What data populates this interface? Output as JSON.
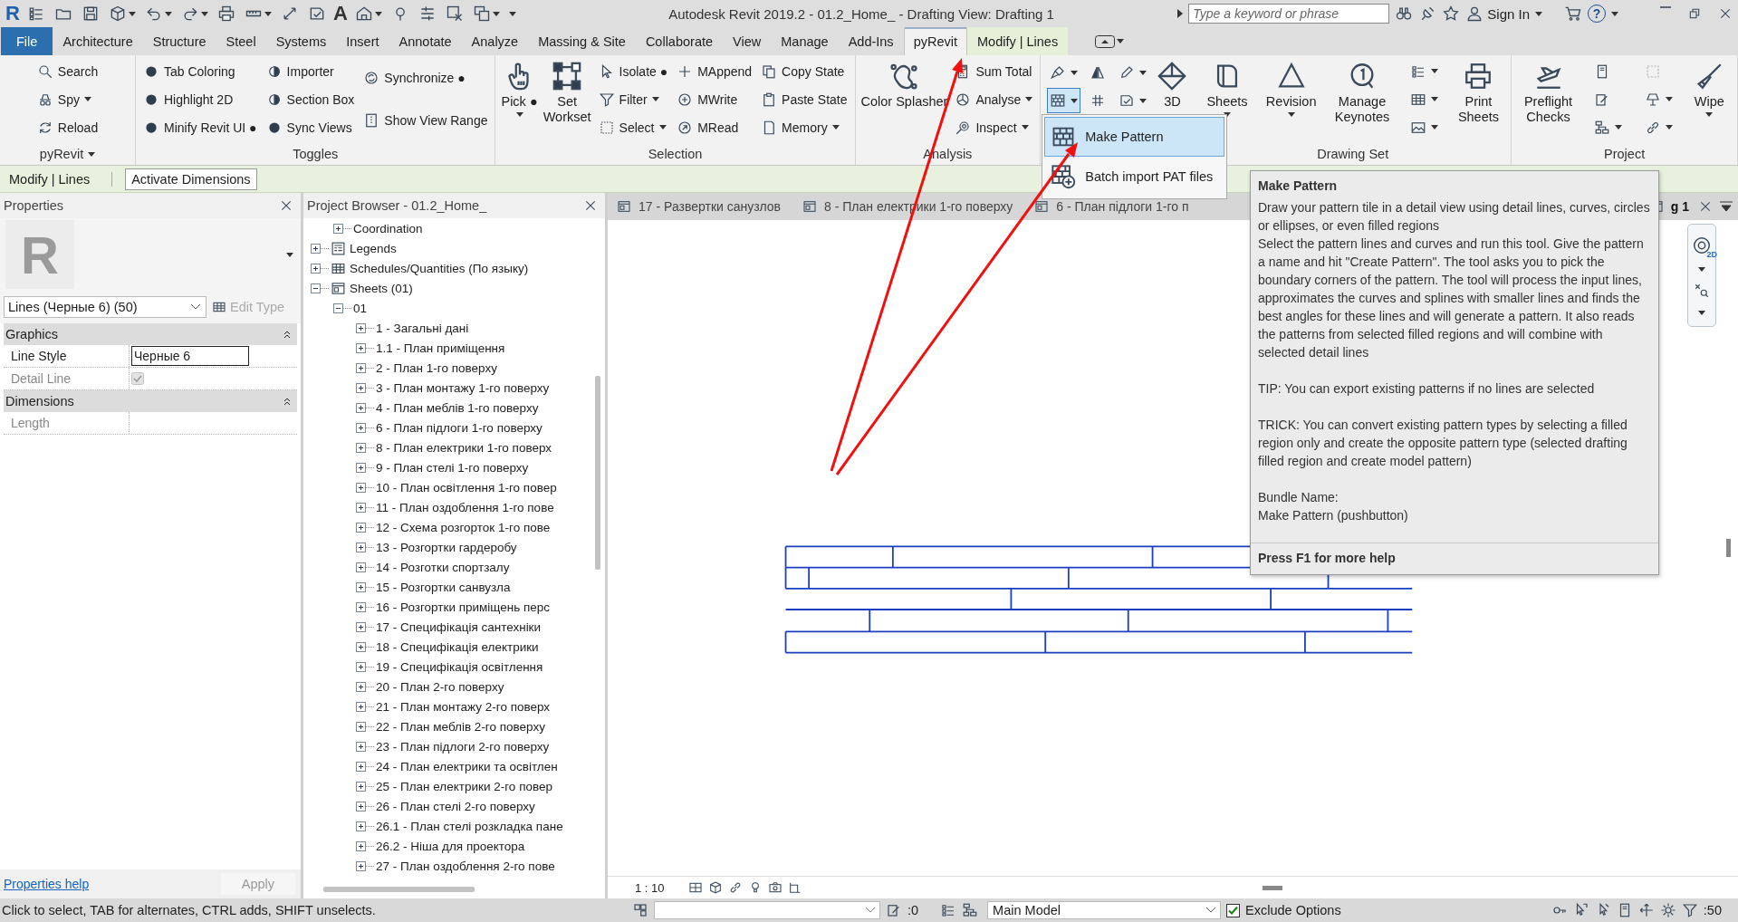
{
  "app_logo": "R",
  "title": "Autodesk Revit 2019.2 - 01.2_Home_ - Drafting View: Drafting 1",
  "qat_text_glyph": "A",
  "search": {
    "placeholder": "Type a keyword or phrase"
  },
  "sign_in": "Sign In",
  "help_glyph": "?",
  "ribbon_tabs": [
    {
      "label": "File",
      "kind": "file",
      "selected": false
    },
    {
      "label": "Architecture",
      "kind": "normal",
      "selected": false
    },
    {
      "label": "Structure",
      "kind": "normal",
      "selected": false
    },
    {
      "label": "Steel",
      "kind": "normal",
      "selected": false
    },
    {
      "label": "Systems",
      "kind": "normal",
      "selected": false
    },
    {
      "label": "Insert",
      "kind": "normal",
      "selected": false
    },
    {
      "label": "Annotate",
      "kind": "normal",
      "selected": false
    },
    {
      "label": "Analyze",
      "kind": "normal",
      "selected": false
    },
    {
      "label": "Massing & Site",
      "kind": "normal",
      "selected": false
    },
    {
      "label": "Collaborate",
      "kind": "normal",
      "selected": false
    },
    {
      "label": "View",
      "kind": "normal",
      "selected": false
    },
    {
      "label": "Manage",
      "kind": "normal",
      "selected": false
    },
    {
      "label": "Add-Ins",
      "kind": "normal",
      "selected": false
    },
    {
      "label": "pyRevit",
      "kind": "normal",
      "selected": true
    },
    {
      "label": "Modify | Lines",
      "kind": "contextual",
      "selected": false
    }
  ],
  "ribbon_panels": [
    {
      "title": "pyRevit",
      "title_dropdown": true,
      "columns": [
        {
          "kind": "stack",
          "items": [
            {
              "label": "Search",
              "dropdown": false
            },
            {
              "label": "Spy",
              "dropdown": true
            },
            {
              "label": "Reload",
              "dropdown": false
            }
          ]
        }
      ]
    },
    {
      "title": "Toggles",
      "title_dropdown": false,
      "columns": [
        {
          "kind": "stack",
          "items": [
            {
              "label": "Tab Coloring",
              "dropdown": false
            },
            {
              "label": "Highlight 2D",
              "dropdown": false
            },
            {
              "label": "Minify Revit UI ●",
              "dropdown": false
            }
          ]
        },
        {
          "kind": "stack",
          "items": [
            {
              "label": "Importer",
              "dropdown": false
            },
            {
              "label": "Section Box",
              "dropdown": false
            },
            {
              "label": "Sync Views",
              "dropdown": false
            }
          ]
        },
        {
          "kind": "stack",
          "items": [
            {
              "label": "Synchronize ●",
              "dropdown": false
            },
            {
              "label": "Show View Range",
              "dropdown": false
            }
          ]
        }
      ]
    },
    {
      "title": "Selection",
      "title_dropdown": false,
      "columns": [
        {
          "kind": "large",
          "label": "Pick ●",
          "dropdown": true
        },
        {
          "kind": "large",
          "label": "Set\nWorkset",
          "dropdown": false
        },
        {
          "kind": "stack",
          "items": [
            {
              "label": "Isolate ●",
              "dropdown": false
            },
            {
              "label": "Filter",
              "dropdown": true
            },
            {
              "label": "Select",
              "dropdown": true
            }
          ]
        },
        {
          "kind": "stack",
          "items": [
            {
              "label": "MAppend",
              "dropdown": false
            },
            {
              "label": "MWrite",
              "dropdown": false
            },
            {
              "label": "MRead",
              "dropdown": false
            }
          ]
        },
        {
          "kind": "stack",
          "items": [
            {
              "label": "Copy State",
              "dropdown": false
            },
            {
              "label": "Paste State",
              "dropdown": false
            },
            {
              "label": "Memory",
              "dropdown": true
            }
          ]
        }
      ]
    },
    {
      "title": "Analysis",
      "title_dropdown": false,
      "columns": [
        {
          "kind": "large",
          "label": "Color Splasher",
          "dropdown": false
        },
        {
          "kind": "stack",
          "items": [
            {
              "label": "Sum Total",
              "dropdown": false
            },
            {
              "label": "Analyse",
              "dropdown": true
            },
            {
              "label": "Inspect",
              "dropdown": true
            }
          ]
        }
      ]
    },
    {
      "columns": [
        {
          "kind": "stack",
          "items": [
            {
              "dropdown": true,
              "pressed": false
            },
            {
              "dropdown": true,
              "pressed": true
            }
          ]
        },
        {
          "kind": "stack",
          "items": [
            {
              "dropdown": false,
              "pressed": false
            },
            {
              "dropdown": false,
              "pressed": false
            }
          ]
        },
        {
          "kind": "stack",
          "items": [
            {
              "dropdown": true,
              "pressed": false
            },
            {
              "dropdown": true,
              "pressed": false
            }
          ]
        },
        {
          "kind": "large",
          "label": "3D",
          "dropdown": false
        }
      ]
    },
    {
      "title": "Drawing Set",
      "title_dropdown": false,
      "columns": [
        {
          "kind": "large",
          "label": "Sheets",
          "dropdown": true
        },
        {
          "kind": "large",
          "label": "Revision",
          "dropdown": true
        },
        {
          "kind": "large",
          "label": "Manage\nKeynotes",
          "dropdown": false
        },
        {
          "kind": "stack",
          "items": [
            {
              "dropdown": true
            },
            {
              "dropdown": true
            },
            {
              "dropdown": true
            }
          ]
        },
        {
          "kind": "large",
          "label": "Print\nSheets",
          "dropdown": false
        }
      ]
    },
    {
      "title": "Project",
      "title_dropdown": false,
      "columns": [
        {
          "kind": "large",
          "label": "Preflight\nChecks",
          "dropdown": false
        },
        {
          "kind": "stack",
          "items": [
            {
              "dropdown": false
            },
            {
              "dropdown": false
            },
            {
              "dropdown": true
            }
          ]
        },
        {
          "kind": "stack",
          "items": [
            {
              "dropdown": false,
              "disabled": true
            },
            {
              "dropdown": true,
              "disabled": false
            },
            {
              "dropdown": true,
              "disabled": false
            }
          ]
        },
        {
          "kind": "large",
          "label": "Wipe",
          "dropdown": true
        }
      ]
    }
  ],
  "dropdown_menu": [
    {
      "label": "Make Pattern",
      "highlighted": true
    },
    {
      "label": "Batch import PAT files",
      "highlighted": false
    }
  ],
  "context_bar": {
    "label": "Modify | Lines",
    "button": "Activate Dimensions"
  },
  "properties": {
    "title": "Properties",
    "thumbnail_letter": "R",
    "type_selector": "Lines (Черные 6) (50)",
    "edit_type": {
      "label": "Edit Type",
      "disabled": true
    },
    "sections": [
      {
        "title": "Graphics",
        "expanded": true,
        "rows": [
          {
            "name": "Line Style",
            "kind": "text",
            "value": "Черные 6",
            "disabled": false
          },
          {
            "name": "Detail Line",
            "kind": "checkbox",
            "checked": true,
            "disabled": true
          }
        ]
      },
      {
        "title": "Dimensions",
        "expanded": true,
        "rows": [
          {
            "name": "Length",
            "kind": "text",
            "disabled": true
          }
        ]
      }
    ],
    "help_link": "Properties help",
    "apply": {
      "label": "Apply",
      "disabled": true
    }
  },
  "project_browser": {
    "title": "Project Browser - 01.2_Home_",
    "tree": [
      {
        "expanded": true,
        "children": [
          {
            "label": "Coordination",
            "expanded": false
          }
        ]
      },
      {
        "label": "Legends",
        "kind": "legends",
        "expanded": false
      },
      {
        "label": "Schedules/Quantities (По языку)",
        "kind": "schedules",
        "expanded": false
      },
      {
        "label": "Sheets (01)",
        "kind": "sheets",
        "expanded": true,
        "children": [
          {
            "label": "01",
            "expanded": true,
            "children": [
              {
                "label": "1 - Загальні дані",
                "expanded": false
              },
              {
                "label": "1.1 - План приміщення",
                "expanded": false
              },
              {
                "label": "2 - План 1-го поверху",
                "expanded": false
              },
              {
                "label": "3 - План монтажу 1-го поверху",
                "expanded": false
              },
              {
                "label": "4 - План меблів 1-го поверху",
                "expanded": false
              },
              {
                "label": "6 - План підлоги 1-го поверху",
                "expanded": false
              },
              {
                "label": "8 - План електрики 1-го поверх",
                "expanded": false
              },
              {
                "label": "9 - План стелі 1-го поверху",
                "expanded": false
              },
              {
                "label": "10 - План освітлення 1-го повер",
                "expanded": false
              },
              {
                "label": "11 - План оздоблення 1-го пове",
                "expanded": false
              },
              {
                "label": "12 - Схема розгорток 1-го пове",
                "expanded": false
              },
              {
                "label": "13 - Розгортки гардеробу",
                "expanded": false
              },
              {
                "label": "14 - Розготки спортзалу",
                "expanded": false
              },
              {
                "label": "15 - Розгортки санвузла",
                "expanded": false
              },
              {
                "label": "16 - Розгортки приміщень перс",
                "expanded": false
              },
              {
                "label": "17 - Специфікація сантехніки",
                "expanded": false
              },
              {
                "label": "18 - Специфікація електрики",
                "expanded": false
              },
              {
                "label": "19 - Специфікація освітлення",
                "expanded": false
              },
              {
                "label": "20 - План 2-го поверху",
                "expanded": false
              },
              {
                "label": "21 - План монтажу 2-го поверх",
                "expanded": false
              },
              {
                "label": "22 - План меблів 2-го поверху",
                "expanded": false
              },
              {
                "label": "23 - План підлоги 2-го поверху",
                "expanded": false
              },
              {
                "label": "24 - План електрики та освітлен",
                "expanded": false
              },
              {
                "label": "25 - План електрики 2-го повер",
                "expanded": false
              },
              {
                "label": "26 - План стелі 2-го поверху",
                "expanded": false
              },
              {
                "label": "26.1 - План стелі розкладка пане",
                "expanded": false
              },
              {
                "label": "26.2 - Ніша для проектора",
                "expanded": false
              },
              {
                "label": "27 - План оздоблення 2-го пове",
                "expanded": false
              }
            ]
          }
        ]
      }
    ]
  },
  "view": {
    "tabs": [
      {
        "label": "17 - Развертки санузлов",
        "selected": false
      },
      {
        "label": "8 - План електрики 1-го поверху",
        "selected": false
      },
      {
        "label": "6 - План підлоги 1-го п",
        "selected": false
      },
      {
        "label": "g 1",
        "selected": true
      }
    ],
    "nav_wheel_label": "2D",
    "scale": "1 : 10"
  },
  "tooltip": {
    "title": "Make Pattern",
    "sections": [
      [
        "Draw your pattern tile in a detail view using detail lines, curves, circles or ellipses, or even filled regions",
        "Select the pattern lines and curves and run this tool. Give the pattern a name and hit \"Create Pattern\". The tool asks you to pick the boundary corners of the pattern. The tool will process the input lines, approximates the curves and splines with smaller lines and finds the best angles for these lines and will generate a pattern. It also reads the patterns from selected filled regions and will combine with selected detail lines"
      ],
      [
        "TIP: You can export existing patterns if no lines are selected"
      ],
      [
        "TRICK: You can convert existing pattern types by selecting a filled region only and create the opposite pattern type (selected drafting filled region and create model pattern)"
      ],
      [
        "Bundle Name:",
        "Make Pattern (pushbutton)"
      ]
    ],
    "footer": "Press F1 for more help"
  },
  "status_bar": {
    "message": "Click to select, TAB for alternates, CTRL adds, SHIFT unselects.",
    "selection_count": ":0",
    "model": "Main Model",
    "exclude_options": {
      "label": "Exclude Options",
      "checked": true
    },
    "filter_count": ":50"
  }
}
